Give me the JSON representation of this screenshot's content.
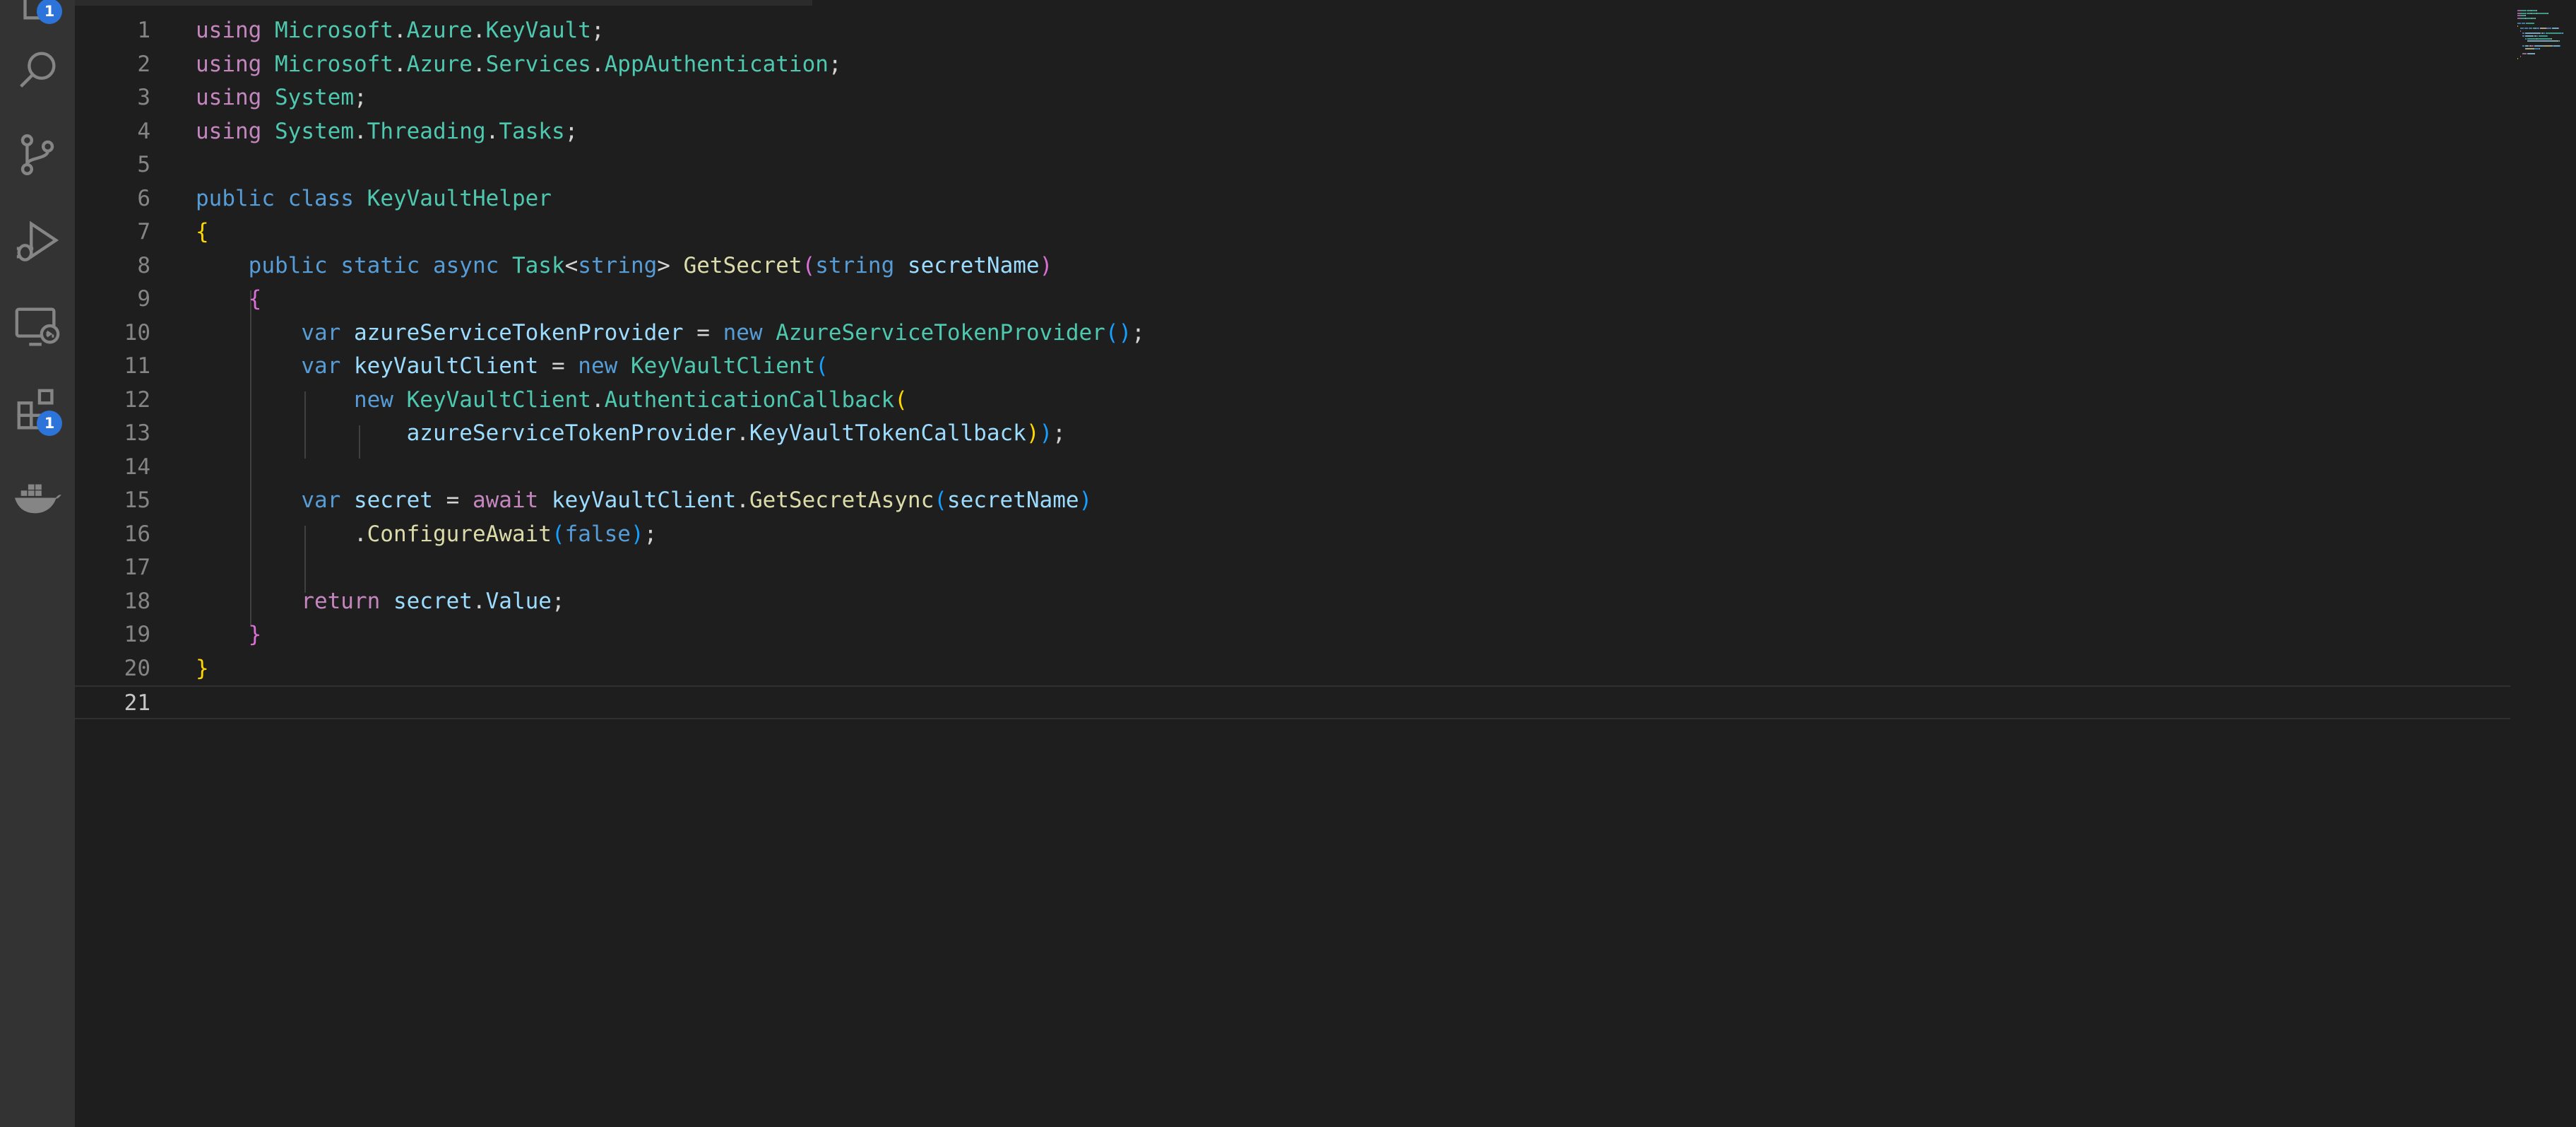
{
  "activity_bar": {
    "items": [
      {
        "name": "explorer",
        "icon": "files-icon",
        "badge": "1"
      },
      {
        "name": "search",
        "icon": "search-icon"
      },
      {
        "name": "source-control",
        "icon": "source-control-icon"
      },
      {
        "name": "run-debug",
        "icon": "run-debug-icon"
      },
      {
        "name": "remote-explorer",
        "icon": "remote-explorer-icon"
      },
      {
        "name": "extensions",
        "icon": "extensions-icon",
        "badge": "1"
      },
      {
        "name": "docker",
        "icon": "docker-icon"
      }
    ]
  },
  "editor": {
    "current_line": 21,
    "colors": {
      "background": "#1e1e1e",
      "keyword": "#c586c0",
      "storage": "#569cd6",
      "type": "#4ec9b0",
      "function": "#dcdcaa",
      "variable": "#9cdcfe",
      "text": "#d4d4d4",
      "bracket1": "#ffd700",
      "bracket2": "#da70d6",
      "bracket3": "#179fff"
    },
    "lines": [
      {
        "n": "1",
        "tokens": [
          [
            "kw",
            "using"
          ],
          [
            "tx",
            " "
          ],
          [
            "ty",
            "Microsoft"
          ],
          [
            "tx",
            "."
          ],
          [
            "ty",
            "Azure"
          ],
          [
            "tx",
            "."
          ],
          [
            "ty",
            "KeyVault"
          ],
          [
            "tx",
            ";"
          ]
        ]
      },
      {
        "n": "2",
        "tokens": [
          [
            "kw",
            "using"
          ],
          [
            "tx",
            " "
          ],
          [
            "ty",
            "Microsoft"
          ],
          [
            "tx",
            "."
          ],
          [
            "ty",
            "Azure"
          ],
          [
            "tx",
            "."
          ],
          [
            "ty",
            "Services"
          ],
          [
            "tx",
            "."
          ],
          [
            "ty",
            "AppAuthentication"
          ],
          [
            "tx",
            ";"
          ]
        ]
      },
      {
        "n": "3",
        "tokens": [
          [
            "kw",
            "using"
          ],
          [
            "tx",
            " "
          ],
          [
            "ty",
            "System"
          ],
          [
            "tx",
            ";"
          ]
        ]
      },
      {
        "n": "4",
        "tokens": [
          [
            "kw",
            "using"
          ],
          [
            "tx",
            " "
          ],
          [
            "ty",
            "System"
          ],
          [
            "tx",
            "."
          ],
          [
            "ty",
            "Threading"
          ],
          [
            "tx",
            "."
          ],
          [
            "ty",
            "Tasks"
          ],
          [
            "tx",
            ";"
          ]
        ]
      },
      {
        "n": "5",
        "tokens": []
      },
      {
        "n": "6",
        "tokens": [
          [
            "kb",
            "public"
          ],
          [
            "tx",
            " "
          ],
          [
            "kb",
            "class"
          ],
          [
            "tx",
            " "
          ],
          [
            "ty",
            "KeyVaultHelper"
          ]
        ]
      },
      {
        "n": "7",
        "tokens": [
          [
            "b1",
            "{"
          ]
        ]
      },
      {
        "n": "8",
        "tokens": [
          [
            "tx",
            "    "
          ],
          [
            "kb",
            "public"
          ],
          [
            "tx",
            " "
          ],
          [
            "kb",
            "static"
          ],
          [
            "tx",
            " "
          ],
          [
            "kb",
            "async"
          ],
          [
            "tx",
            " "
          ],
          [
            "ty",
            "Task"
          ],
          [
            "tx",
            "<"
          ],
          [
            "kb",
            "string"
          ],
          [
            "tx",
            "> "
          ],
          [
            "fn",
            "GetSecret"
          ],
          [
            "b2",
            "("
          ],
          [
            "kb",
            "string"
          ],
          [
            "tx",
            " "
          ],
          [
            "vr",
            "secretName"
          ],
          [
            "b2",
            ")"
          ]
        ]
      },
      {
        "n": "9",
        "tokens": [
          [
            "tx",
            "    "
          ],
          [
            "b2",
            "{"
          ]
        ]
      },
      {
        "n": "10",
        "tokens": [
          [
            "tx",
            "        "
          ],
          [
            "kb",
            "var"
          ],
          [
            "tx",
            " "
          ],
          [
            "vr",
            "azureServiceTokenProvider"
          ],
          [
            "tx",
            " = "
          ],
          [
            "kb",
            "new"
          ],
          [
            "tx",
            " "
          ],
          [
            "ty",
            "AzureServiceTokenProvider"
          ],
          [
            "b3",
            "()"
          ],
          [
            "tx",
            ";"
          ]
        ]
      },
      {
        "n": "11",
        "tokens": [
          [
            "tx",
            "        "
          ],
          [
            "kb",
            "var"
          ],
          [
            "tx",
            " "
          ],
          [
            "vr",
            "keyVaultClient"
          ],
          [
            "tx",
            " = "
          ],
          [
            "kb",
            "new"
          ],
          [
            "tx",
            " "
          ],
          [
            "ty",
            "KeyVaultClient"
          ],
          [
            "b3",
            "("
          ]
        ]
      },
      {
        "n": "12",
        "tokens": [
          [
            "tx",
            "            "
          ],
          [
            "kb",
            "new"
          ],
          [
            "tx",
            " "
          ],
          [
            "ty",
            "KeyVaultClient"
          ],
          [
            "tx",
            "."
          ],
          [
            "ty",
            "AuthenticationCallback"
          ],
          [
            "b1",
            "("
          ]
        ]
      },
      {
        "n": "13",
        "tokens": [
          [
            "tx",
            "                "
          ],
          [
            "vr",
            "azureServiceTokenProvider"
          ],
          [
            "tx",
            "."
          ],
          [
            "vr",
            "KeyVaultTokenCallback"
          ],
          [
            "b1",
            ")"
          ],
          [
            "b3",
            ")"
          ],
          [
            "tx",
            ";"
          ]
        ]
      },
      {
        "n": "14",
        "tokens": []
      },
      {
        "n": "15",
        "tokens": [
          [
            "tx",
            "        "
          ],
          [
            "kb",
            "var"
          ],
          [
            "tx",
            " "
          ],
          [
            "vr",
            "secret"
          ],
          [
            "tx",
            " = "
          ],
          [
            "kw",
            "await"
          ],
          [
            "tx",
            " "
          ],
          [
            "vr",
            "keyVaultClient"
          ],
          [
            "tx",
            "."
          ],
          [
            "fn",
            "GetSecretAsync"
          ],
          [
            "b3",
            "("
          ],
          [
            "vr",
            "secretName"
          ],
          [
            "b3",
            ")"
          ]
        ]
      },
      {
        "n": "16",
        "tokens": [
          [
            "tx",
            "            ."
          ],
          [
            "fn",
            "ConfigureAwait"
          ],
          [
            "b3",
            "("
          ],
          [
            "kb",
            "false"
          ],
          [
            "b3",
            ")"
          ],
          [
            "tx",
            ";"
          ]
        ]
      },
      {
        "n": "17",
        "tokens": []
      },
      {
        "n": "18",
        "tokens": [
          [
            "tx",
            "        "
          ],
          [
            "kw",
            "return"
          ],
          [
            "tx",
            " "
          ],
          [
            "vr",
            "secret"
          ],
          [
            "tx",
            "."
          ],
          [
            "vr",
            "Value"
          ],
          [
            "tx",
            ";"
          ]
        ]
      },
      {
        "n": "19",
        "tokens": [
          [
            "tx",
            "    "
          ],
          [
            "b2",
            "}"
          ]
        ]
      },
      {
        "n": "20",
        "tokens": [
          [
            "b1",
            "}"
          ]
        ]
      },
      {
        "n": "21",
        "tokens": []
      }
    ]
  }
}
